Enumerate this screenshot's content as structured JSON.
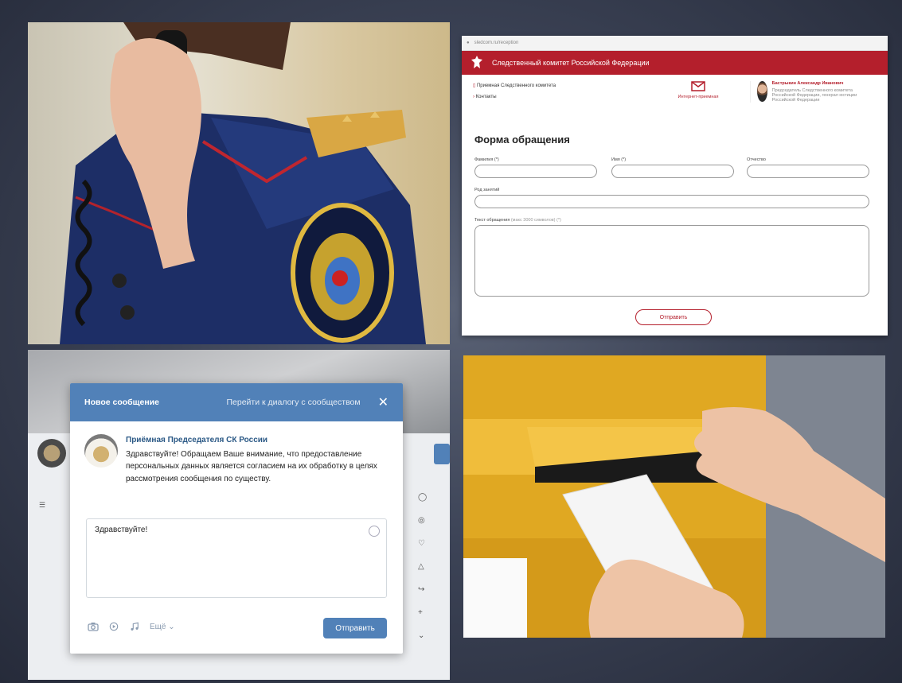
{
  "form_panel": {
    "browser_url": "sledcom.ru/reception",
    "site_title": "Следственный комитет Российской Федерации",
    "nav_reception": "Приемная Следственного комитета",
    "nav_contacts": "Контакты",
    "internet_reception": "Интернет-приемная",
    "person_name": "Бастрыкин Александр Иванович",
    "person_post": "Председатель Следственного комитета Российской Федерации, генерал юстиции Российской Федерации",
    "form_title": "Форма обращения",
    "label_surname": "Фамилия (*)",
    "label_name": "Имя (*)",
    "label_patronymic": "Отчество",
    "label_occupation": "Род занятий",
    "label_text": "Текст обращения",
    "label_text_hint": "(макс 3000 символов) (*)",
    "submit_label": "Отправить"
  },
  "vk_dialog": {
    "title": "Новое сообщение",
    "goto_dialog": "Перейти к диалогу с сообществом",
    "close_glyph": "✕",
    "author": "Приёмная Председателя СК России",
    "message": "Здравствуйте! Обращаем Ваше внимание, что предоставление персональных данных является согласием на их обработку в целях рассмотрения сообщения по существу.",
    "draft": "Здравствуйте!",
    "more_label": "Ещё",
    "send_label": "Отправить",
    "icons": [
      "camera-icon",
      "video-icon",
      "music-icon"
    ],
    "accent": "#5181b8"
  },
  "colors": {
    "sk_red": "#b41f2c",
    "vk_blue": "#5181b8"
  }
}
